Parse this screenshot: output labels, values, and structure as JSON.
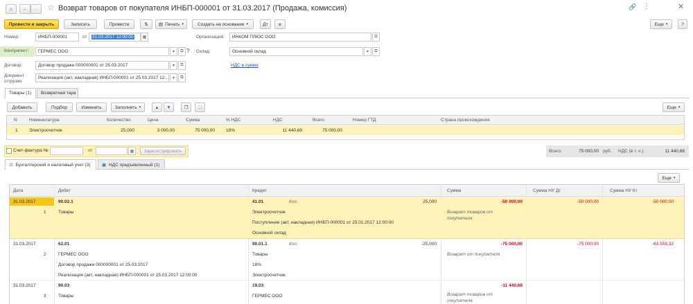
{
  "window": {
    "title": "Возврат товаров от покупателя ИНБП-000001 от 31.03.2017 (Продажа, комиссия)"
  },
  "toolbar": {
    "post_and_close": "Провести и закрыть",
    "save": "Записать",
    "post": "Провести",
    "print": "Печать",
    "create_based_on": "Создать на основании",
    "more": "Еще",
    "help": "?"
  },
  "form": {
    "number_label": "Номер:",
    "number_value": "ИНБП-000001",
    "from_label": "от",
    "date_value": "31.03.2017 12:00:00",
    "org_label": "Организация:",
    "org_value": "ИНКОМ ПЛЮС ООО",
    "contractor_label": "Контрагент:",
    "contractor_value": "ГЕРМЕС ООО",
    "warehouse_label": "Склад:",
    "warehouse_value": "Основной склад",
    "contract_label": "Договор:",
    "contract_value": "Договор продажи 000000001 от 25.03.2017",
    "vat_link": "НДС в сумме",
    "shipment_label_1": "Документ",
    "shipment_label_2": "отгрузки:",
    "shipment_value": "Реализация (акт, накладная) ИНБП-000001 от 25.03.2017 12:..."
  },
  "tabs": {
    "goods": "Товары (1)",
    "container": "Возвратная тара"
  },
  "goods_toolbar": {
    "add": "Добавить",
    "pick": "Подбор",
    "change": "Изменить",
    "fill": "Заполнить",
    "more": "Еще"
  },
  "goods_table": {
    "headers": [
      "N",
      "Номенклатура",
      "Количество",
      "Цена",
      "Сумма",
      "% НДС",
      "НДС",
      "Всего",
      "Номер ГТД",
      "Страна происхождения"
    ],
    "rows": [
      [
        "1",
        "Электросчетчик",
        "25,000",
        "3 000,00",
        "75 000,00",
        "18%",
        "11 440,68",
        "75 000,00",
        "",
        ""
      ]
    ]
  },
  "invoice": {
    "label": "Счет-фактура №",
    "from": "от",
    "date_placeholder": ". .",
    "register": "Зарегистрировать"
  },
  "totals": {
    "total_label": "Всего:",
    "total_value": "75 000,00",
    "currency": "руб.",
    "vat_label": "НДС (в т. ч.):",
    "vat_value": "11 440,68"
  },
  "lower_tabs": {
    "accounting": "Бухгалтерский и налоговый учет (3)",
    "vat_presented": "НДС предъявленный (1)"
  },
  "ledger": {
    "more": "Еще",
    "headers": {
      "date": "Дата",
      "debit": "Дебет",
      "credit": "Кредит",
      "amount": "Сумма",
      "amount_nu_dt": "Сумма НУ Дт",
      "amount_nu_kt": "Сумма НУ Кт"
    },
    "entries": [
      {
        "date": "31.03.2017",
        "num": "1",
        "debit_account": "90.02.1",
        "debit_lines": [
          "Товары"
        ],
        "credit_account": "41.01",
        "credit_qty_label": "Кол.",
        "credit_qty": "25,000",
        "credit_lines": [
          "Электросчетчик",
          "Поступление (акт, накладная) ИНБП-000001 от 25.01.2017 12:00:00",
          "Основной склад"
        ],
        "amount": "-50 000,00",
        "comment_1": "Возврат товаров от",
        "comment_2": "покупателя",
        "nu_dt": "-50 000,00",
        "nu_kt": "-50 000,00"
      },
      {
        "date": "31.03.2017",
        "num": "2",
        "debit_account": "62.01",
        "debit_lines": [
          "ГЕРМЕС ООО",
          "Договор продажи 000000001 от 25.03.2017",
          "Реализация (акт, накладная) ИНБП-000001 от 25.03.2017 12:00:00"
        ],
        "credit_account": "90.01.1",
        "credit_qty_label": "Кол.",
        "credit_qty": "-25,000",
        "credit_lines": [
          "Товары",
          "18%",
          "Электросчетчик"
        ],
        "amount": "-75 000,00",
        "comment_1": "Возврат от покупателя",
        "comment_2": "",
        "nu_dt": "-75 000,00",
        "nu_kt": "-63 559,32"
      },
      {
        "date": "31.03.2017",
        "num": "3",
        "debit_account": "90.03",
        "debit_lines": [
          "Товары"
        ],
        "credit_account": "19.03",
        "credit_qty_label": "",
        "credit_qty": "",
        "credit_lines": [
          "ГЕРМЕС ООО"
        ],
        "amount": "-11 440,68",
        "comment_1": "Возврат товаров от",
        "comment_2": "покупателя",
        "nu_dt": "",
        "nu_kt": ""
      }
    ]
  },
  "colors": {
    "accent_yellow": "#f5c518",
    "selected_row": "#fdf2b8",
    "negative": "#d0021b",
    "link": "#1a56b0"
  }
}
